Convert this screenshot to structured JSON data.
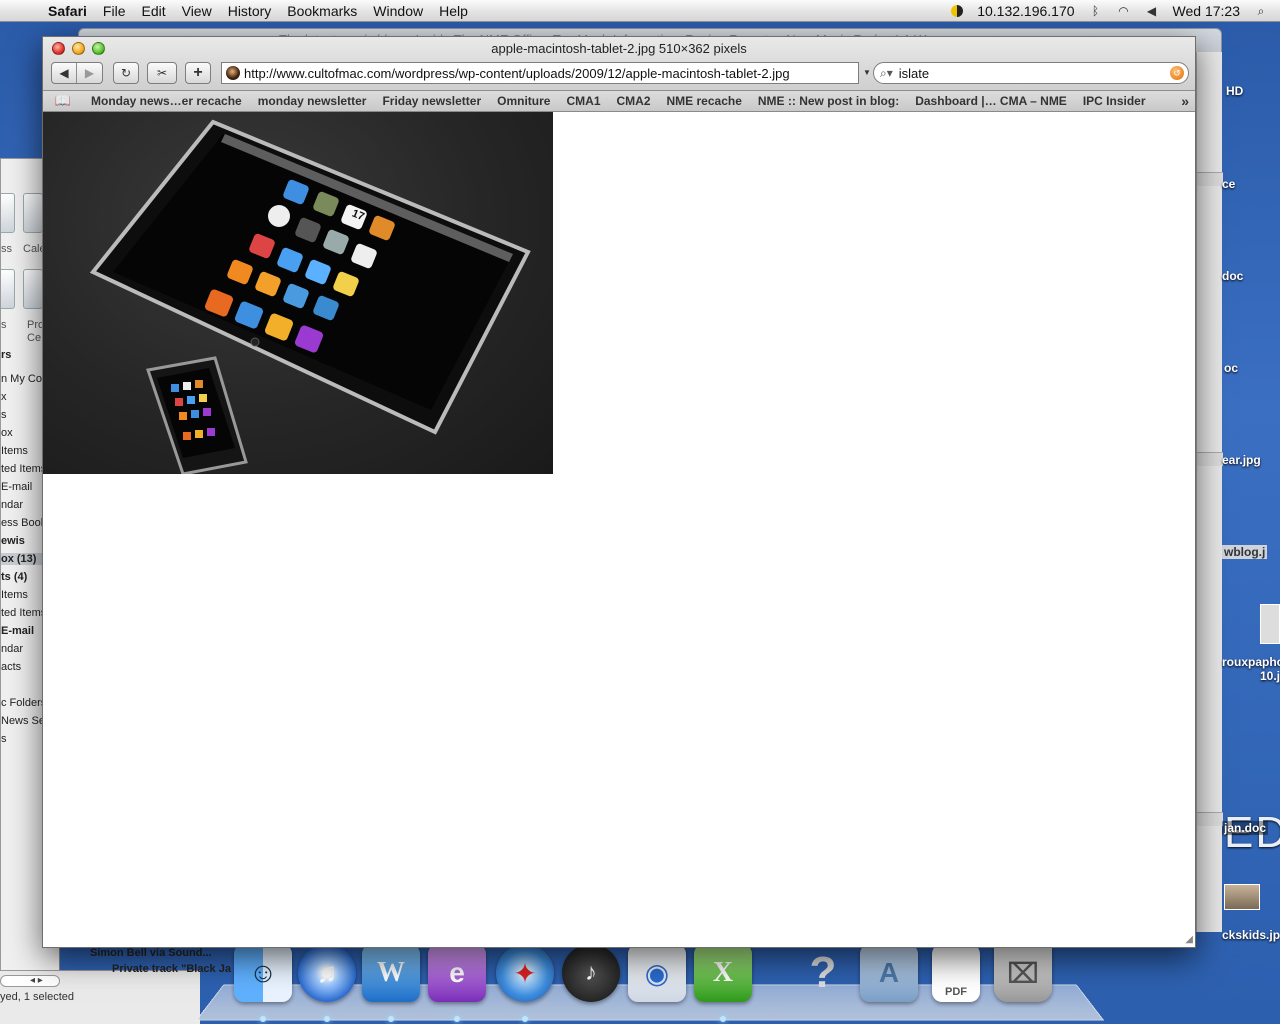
{
  "menubar": {
    "app_name": "Safari",
    "menus": [
      "File",
      "Edit",
      "View",
      "History",
      "Bookmarks",
      "Window",
      "Help"
    ],
    "ip": "10.132.196.170",
    "clock": "Wed 17:23"
  },
  "behind_window": {
    "title": "The latest music blogs, Inside The NME Office, Too Much Information, Roving Reporter, New Music Radar, LA Women..."
  },
  "safari": {
    "title": "apple-macintosh-tablet-2.jpg 510×362 pixels",
    "url": "http://www.cultofmac.com/wordpress/wp-content/uploads/2009/12/apple-macintosh-tablet-2.jpg",
    "search_value": "islate",
    "bookmarks": [
      "Monday news…er recache",
      "monday newsletter",
      "Friday newsletter",
      "Omniture",
      "CMA1",
      "CMA2",
      "NME recache",
      "NME :: New post in blog:",
      "Dashboard |… CMA – NME",
      "IPC Insider"
    ],
    "image": {
      "tablet_date": "17",
      "phone_visible": true
    }
  },
  "mail_sidebar": {
    "items": [
      {
        "label": "rs",
        "bold": true
      },
      {
        "label": "n My Com",
        "bold": false
      },
      {
        "label": "x",
        "bold": false
      },
      {
        "label": "s",
        "bold": false
      },
      {
        "label": "ox",
        "bold": false
      },
      {
        "label": "Items",
        "bold": false
      },
      {
        "label": "ted Items",
        "bold": false
      },
      {
        "label": "E-mail",
        "bold": false
      },
      {
        "label": "ndar",
        "bold": false
      },
      {
        "label": "ess Book",
        "bold": false
      },
      {
        "label": "ewis",
        "bold": true
      },
      {
        "label": "ox (13)",
        "bold": true
      },
      {
        "label": "ts (4)",
        "bold": true
      },
      {
        "label": "Items",
        "bold": false
      },
      {
        "label": "ted Items",
        "bold": false
      },
      {
        "label": "E-mail",
        "bold": true
      },
      {
        "label": "ndar",
        "bold": false
      },
      {
        "label": "acts",
        "bold": false
      },
      {
        "label": "c Folders",
        "bold": false
      },
      {
        "label": "News Se",
        "bold": false
      },
      {
        "label": "s",
        "bold": false
      }
    ],
    "icon_captions": [
      "ss",
      "Cale",
      "s",
      "Pro\nCe"
    ],
    "status": "yed, 1 selected",
    "message_sender": "Simon Bell via Sound...",
    "message_subject": "Private track \"Black Ja"
  },
  "desktop": {
    "labels": [
      "HD",
      "ce",
      "doc",
      "oc",
      "ear.jpg",
      "wblog.j",
      "rouxpapho\n10.j",
      "jan.doc",
      "ckskids.jp"
    ],
    "big_text": "EDI"
  },
  "dock": {
    "icons": [
      "finder-icon",
      "itunes-icon",
      "word-icon",
      "entourage-icon",
      "safari-icon",
      "dashboard-icon",
      "iphoto-icon",
      "excel-icon",
      "unknown-app-icon",
      "applications-folder-icon",
      "pdf-document-icon",
      "trash-icon"
    ]
  },
  "colors": {
    "desktop_blue": "#2f63b4",
    "accent_orange": "#e46e00"
  }
}
